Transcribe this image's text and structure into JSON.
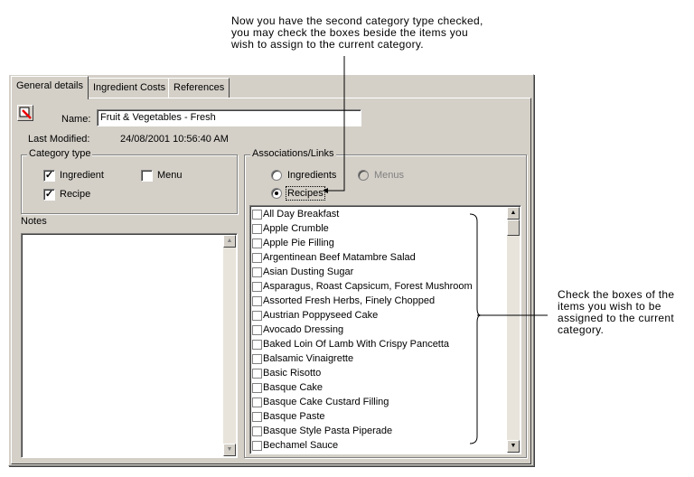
{
  "callouts": {
    "top": [
      "Now you have the second category type checked,",
      "you may check the boxes beside the items you",
      "wish to assign to the current category."
    ],
    "right": [
      "Check the boxes of the",
      "items you wish to be",
      "assigned to the current",
      "category."
    ]
  },
  "tabs": [
    {
      "label": "General details",
      "active": true
    },
    {
      "label": "Ingredient Costs"
    },
    {
      "label": "References"
    }
  ],
  "form": {
    "name_label": "Name:",
    "name_value": "Fruit & Vegetables - Fresh",
    "modified_label": "Last Modified:",
    "modified_value": "24/08/2001 10:56:40 AM",
    "category_type": {
      "legend": "Category type",
      "ingredient": {
        "label": "Ingredient",
        "checked": true
      },
      "menu": {
        "label": "Menu",
        "checked": false
      },
      "recipe": {
        "label": "Recipe",
        "checked": true
      }
    },
    "notes_label": "Notes",
    "associations": {
      "legend": "Associations/Links",
      "ingredients": "Ingredients",
      "menus": "Menus",
      "recipes": "Recipes",
      "selected": "Recipes"
    }
  },
  "items": [
    "All Day Breakfast",
    "Apple Crumble",
    "Apple Pie Filling",
    "Argentinean Beef Matambre Salad",
    "Asian Dusting Sugar",
    "Asparagus, Roast Capsicum, Forest Mushroom",
    "Assorted Fresh Herbs, Finely Chopped",
    "Austrian Poppyseed Cake",
    "Avocado Dressing",
    "Baked Loin Of Lamb With Crispy Pancetta",
    "Balsamic Vinaigrette",
    "Basic Risotto",
    "Basque Cake",
    "Basque Cake Custard Filling",
    "Basque Paste",
    "Basque Style Pasta Piperade",
    "Bechamel Sauce"
  ]
}
